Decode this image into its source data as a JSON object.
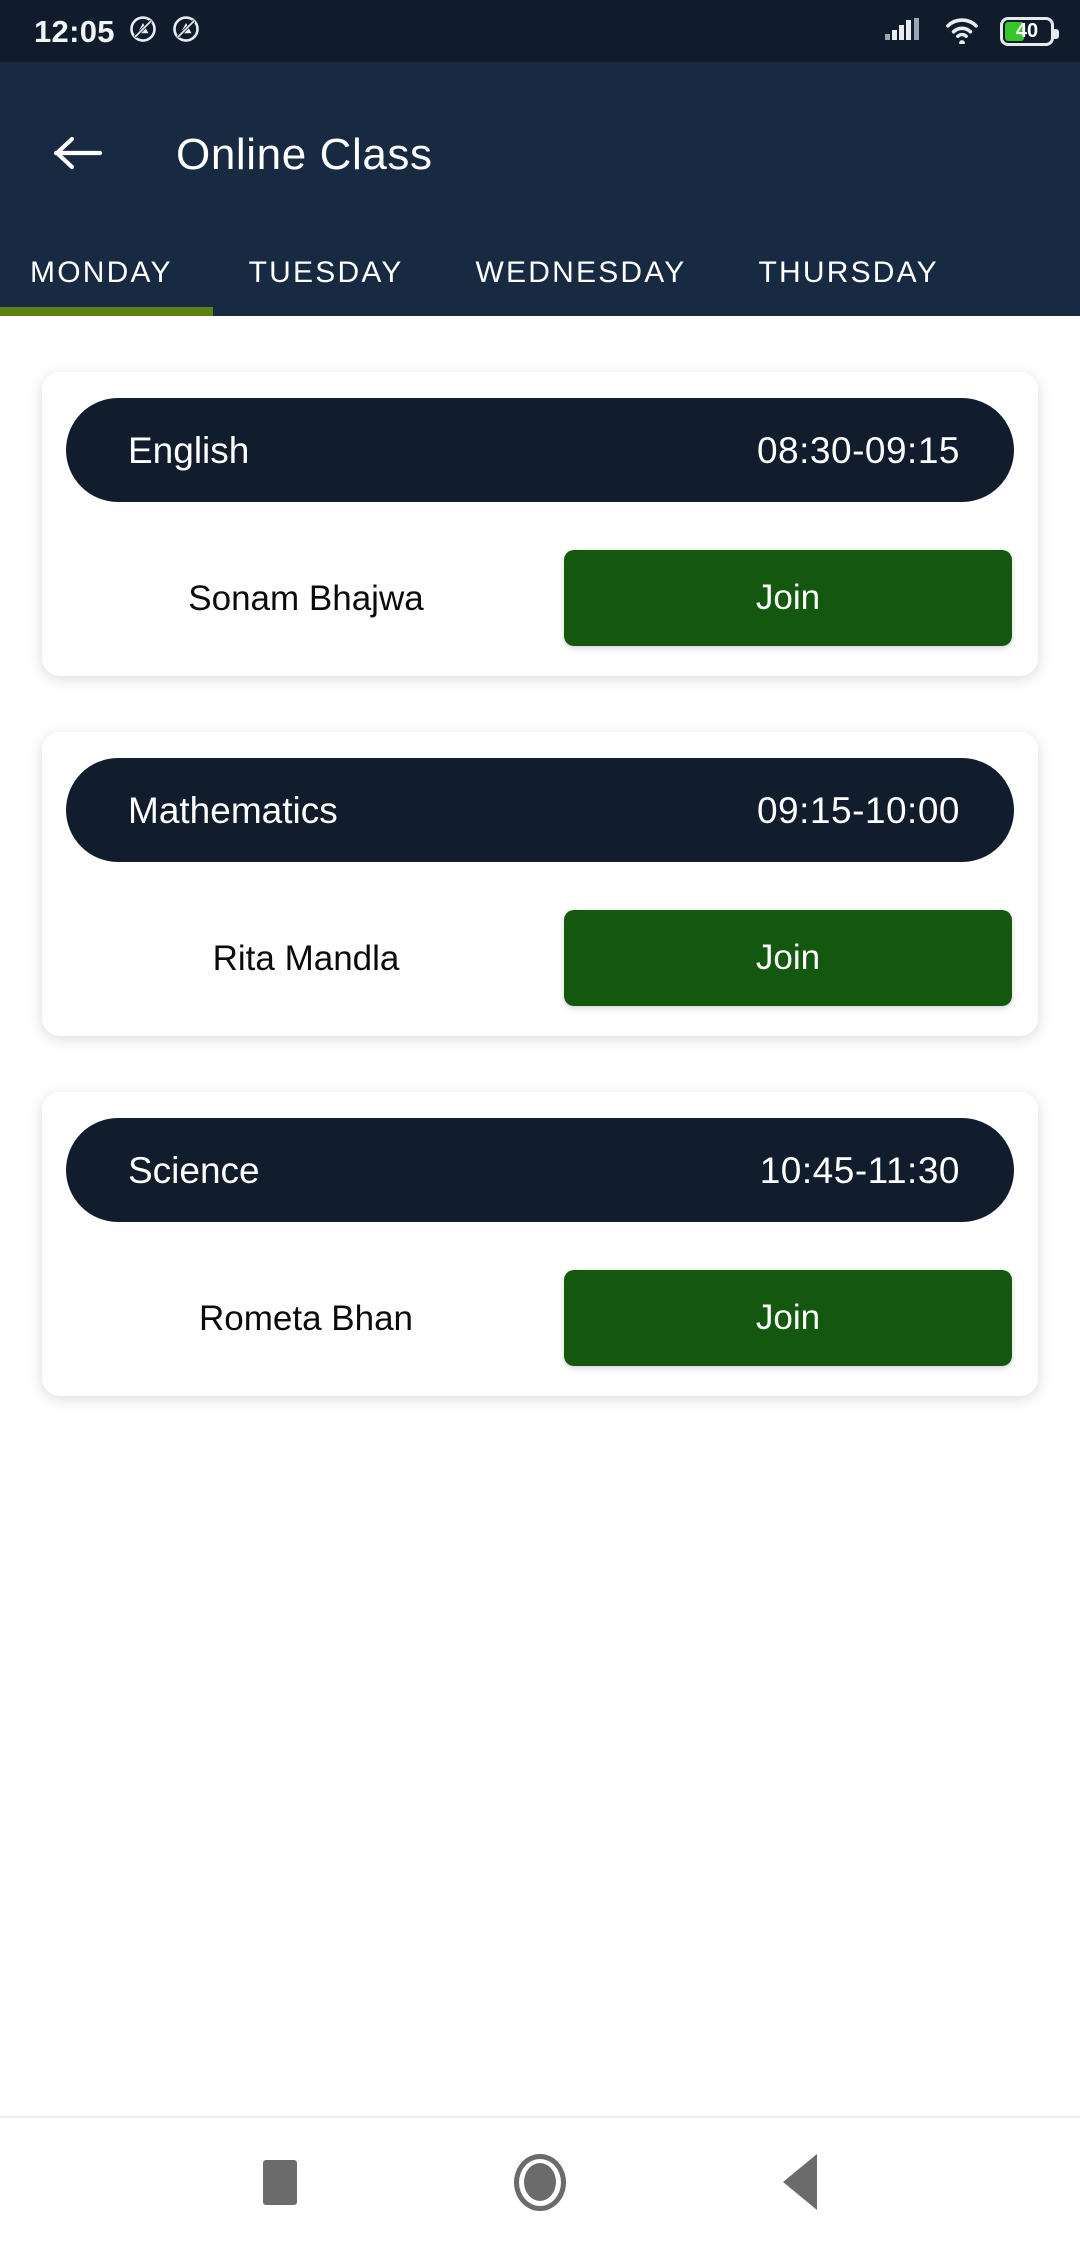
{
  "status_bar": {
    "time": "12:05",
    "dnd_icon_1": "do-not-disturb-icon",
    "dnd_icon_2": "do-not-disturb-icon",
    "signal_icon": "cellular-signal-icon",
    "wifi_icon": "wifi-icon",
    "battery_level": "40",
    "battery_percent": 40,
    "background_color": "#101c2b"
  },
  "app_bar": {
    "back_icon": "back-arrow-icon",
    "title": "Online Class",
    "background_color": "#172a42"
  },
  "tabs": {
    "active_index": 0,
    "indicator_color": "#5c8011",
    "items": [
      {
        "label": "MONDAY"
      },
      {
        "label": "TUESDAY"
      },
      {
        "label": "WEDNESDAY"
      },
      {
        "label": "THURSDAY"
      }
    ]
  },
  "classes": [
    {
      "subject": "English",
      "time": "08:30-09:15",
      "teacher": "Sonam Bhajwa",
      "join_label": "Join"
    },
    {
      "subject": "Mathematics",
      "time": "09:15-10:00",
      "teacher": "Rita Mandla",
      "join_label": "Join"
    },
    {
      "subject": "Science",
      "time": "10:45-11:30",
      "teacher": "Rometa Bhan",
      "join_label": "Join"
    }
  ],
  "colors": {
    "pill_background": "#111d2c",
    "join_button": "#14570f",
    "page_background": "#ffffff"
  },
  "nav_bar": {
    "recents_icon": "square-recents-icon",
    "home_icon": "circle-home-icon",
    "back_icon": "triangle-back-icon"
  }
}
